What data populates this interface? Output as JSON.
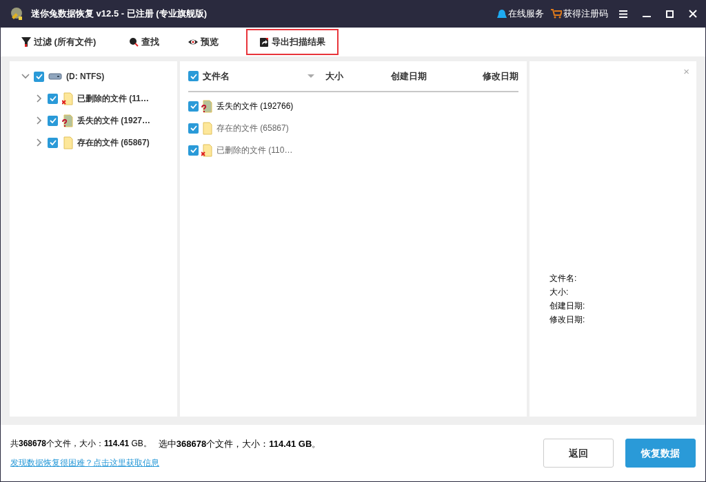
{
  "window": {
    "title": "迷你兔数据恢复 v12.5 - 已注册 (专业旗舰版)",
    "links": [
      {
        "kind": "service",
        "label": "在线服务"
      },
      {
        "kind": "cart",
        "label": "获得注册码"
      }
    ]
  },
  "toolbar": [
    {
      "kind": "filter",
      "label": "过滤 (所有文件)",
      "highlighted": false
    },
    {
      "kind": "search",
      "label": "查找",
      "highlighted": false
    },
    {
      "kind": "preview",
      "label": "预览",
      "highlighted": false
    },
    {
      "kind": "export",
      "label": "导出扫描结果",
      "highlighted": true
    }
  ],
  "tree": [
    {
      "kind": "drive",
      "label": "(D: NTFS)",
      "checked": true,
      "expanded": true,
      "children": [
        {
          "kind": "deleted",
          "label": "已删除的文件 (11…",
          "checked": true,
          "expanded": false
        },
        {
          "kind": "lost",
          "label": "丢失的文件 (1927…",
          "checked": true,
          "expanded": false
        },
        {
          "kind": "existing",
          "label": "存在的文件 (65867)",
          "checked": true,
          "expanded": false
        }
      ]
    }
  ],
  "table": {
    "header_checked": true,
    "columns": [
      "文件名",
      "大小",
      "创建日期",
      "修改日期"
    ],
    "rows": [
      {
        "kind": "lost",
        "name": "丢失的文件 (192766)",
        "checked": true,
        "selected": true
      },
      {
        "kind": "existing",
        "name": "存在的文件 (65867)",
        "checked": true,
        "selected": false
      },
      {
        "kind": "deleted",
        "name": "已删除的文件 (110…",
        "checked": true,
        "selected": false
      }
    ]
  },
  "preview": {
    "close": "×",
    "fields": [
      "文件名:",
      "大小:",
      "创建日期:",
      "修改日期:"
    ]
  },
  "status_bar": {
    "summary": "共**368678**个文件，大小：**114.41** GB。",
    "selection": "选中**368678**个文件，大小：**114.41 GB**。",
    "help_link": "发现数据恢复很困难？点击这里获取信息",
    "buttons": [
      {
        "kind": "secondary",
        "label": "返回"
      },
      {
        "kind": "primary",
        "label": "恢复数据"
      }
    ]
  }
}
